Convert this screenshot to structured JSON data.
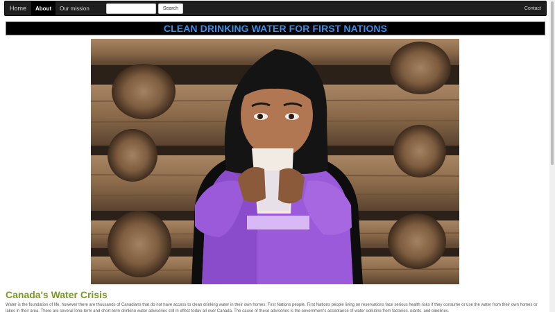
{
  "nav": {
    "home": "Home",
    "about": "About",
    "mission": "Our mission",
    "search_placeholder": "",
    "search_button": "Search",
    "contact": "Contact"
  },
  "banner": {
    "title": "CLEAN DRINKING WATER FOR FIRST NATIONS"
  },
  "hero": {
    "image_icon": "girl-drinking-water-illustration"
  },
  "content": {
    "heading": "Canada's Water Crisis",
    "paragraph": "Water is the foundation of life, however there are thousands of Canadians that do not have access to clean drinking water in their own homes: First Nations people. First Nations people living on reservations face serious health risks if they consume or use the water from their own homes or lakes in their area. There are several long-term and short-term drinking water advisories still in effect today all over Canada. The cause of these advisories is the government's acceptance of water polluting from factories, plants, and pipelines."
  },
  "colors": {
    "navbar": "#1f1f1f",
    "banner_text": "#3b8fe6",
    "heading": "#7a9a25"
  }
}
